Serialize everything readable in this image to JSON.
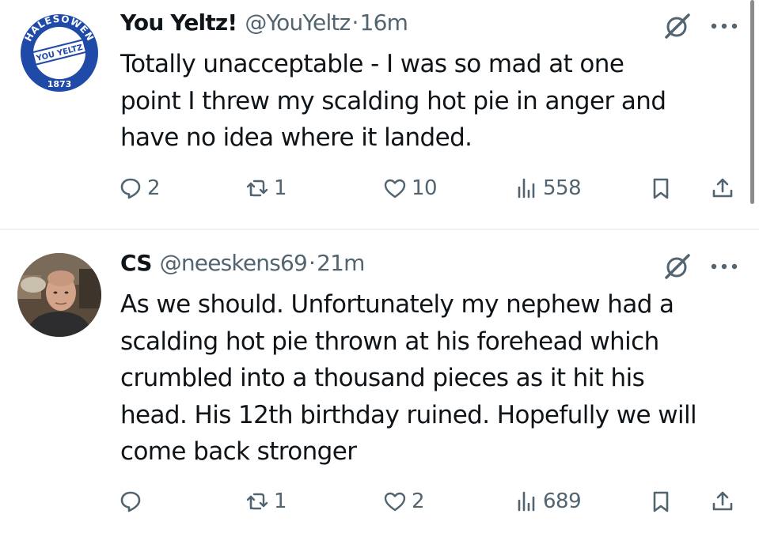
{
  "tweets": [
    {
      "display_name": "You Yeltz!",
      "handle": "@YouYeltz",
      "separator": "·",
      "time": "16m",
      "avatar_icon": "club-badge-icon",
      "avatar_badge": {
        "top_text": "HALESOWEN",
        "middle_text": "YOU YELTZ",
        "year": "1873",
        "color": "#1f4aa8"
      },
      "text": "Totally unacceptable - I was so mad at one\npoint I threw my scalding hot pie in anger and\nhave no idea where it landed.",
      "replies": "2",
      "reposts": "1",
      "likes": "10",
      "views": "558"
    },
    {
      "display_name": "CS",
      "handle": "@neeskens69",
      "separator": "·",
      "time": "21m",
      "avatar_icon": "user-photo-avatar",
      "text": "As we should. Unfortunately my nephew had a\nscalding hot pie thrown at his forehead which\ncrumbled into a thousand pieces as it hit his\nhead. His 12th birthday ruined. Hopefully we will\ncome back stronger",
      "replies": "",
      "reposts": "1",
      "likes": "2",
      "views": "689"
    }
  ],
  "icons": {
    "reply": "reply-icon",
    "repost": "repost-icon",
    "like": "heart-icon",
    "views": "views-icon",
    "bookmark": "bookmark-icon",
    "share": "share-icon",
    "grok": "grok-icon",
    "more": "more-icon"
  },
  "colors": {
    "text": "#0f1419",
    "secondary": "#536471",
    "divider": "#eff3f4"
  }
}
